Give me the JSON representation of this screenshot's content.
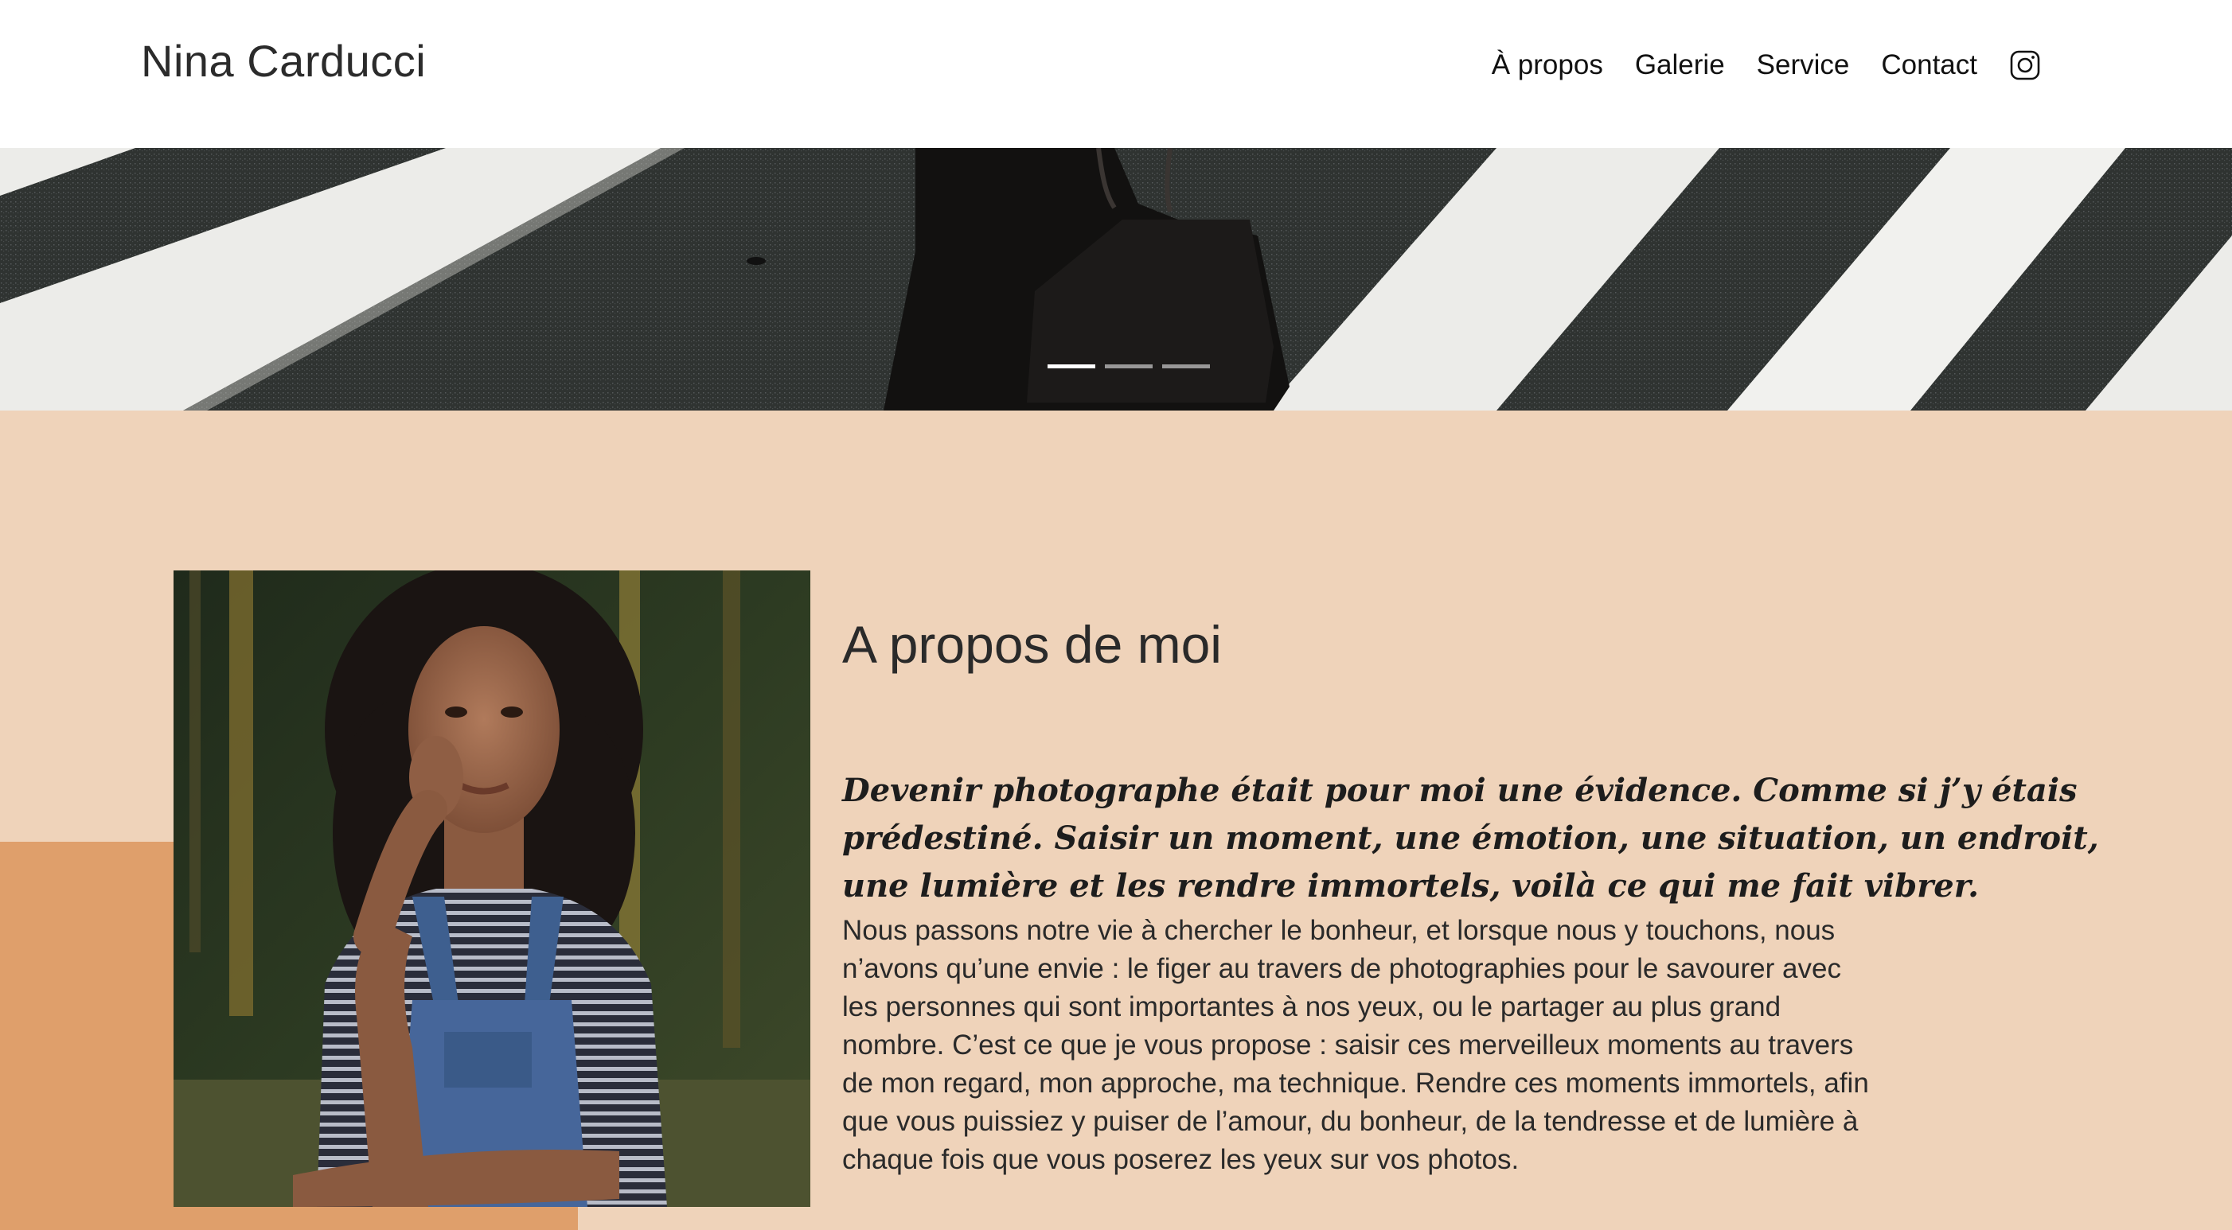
{
  "header": {
    "brand": "Nina Carducci",
    "nav": [
      {
        "label": "À propos"
      },
      {
        "label": "Galerie"
      },
      {
        "label": "Service"
      },
      {
        "label": "Contact"
      }
    ],
    "instagram_icon": "instagram-icon"
  },
  "hero": {
    "slides": 3,
    "active_slide": 1
  },
  "about": {
    "title": "A propos de moi",
    "quote": "Devenir photographe était pour moi une évidence. Comme si j’y étais prédestiné. Saisir un moment, une émotion, une situation, un endroit, une lumière et les rendre immortels, voilà ce qui me fait vibrer.",
    "body": "Nous passons notre vie à chercher le bonheur, et lorsque nous y touchons, nous n’avons qu’une envie : le figer au travers de photographies pour le savourer avec les personnes qui sont importantes à nos yeux, ou le partager au plus grand nombre. C’est ce que je vous propose : saisir ces merveilleux moments au travers de mon regard, mon approche, ma technique. Rendre ces moments immortels, afin que vous puissiez y puiser de l’amour, du bonheur, de la tendresse et de lumière à chaque fois que vous poserez les yeux sur vos photos."
  },
  "colors": {
    "section_bg": "#efd3ba",
    "accent": "#df9f6b",
    "text": "#222222"
  }
}
